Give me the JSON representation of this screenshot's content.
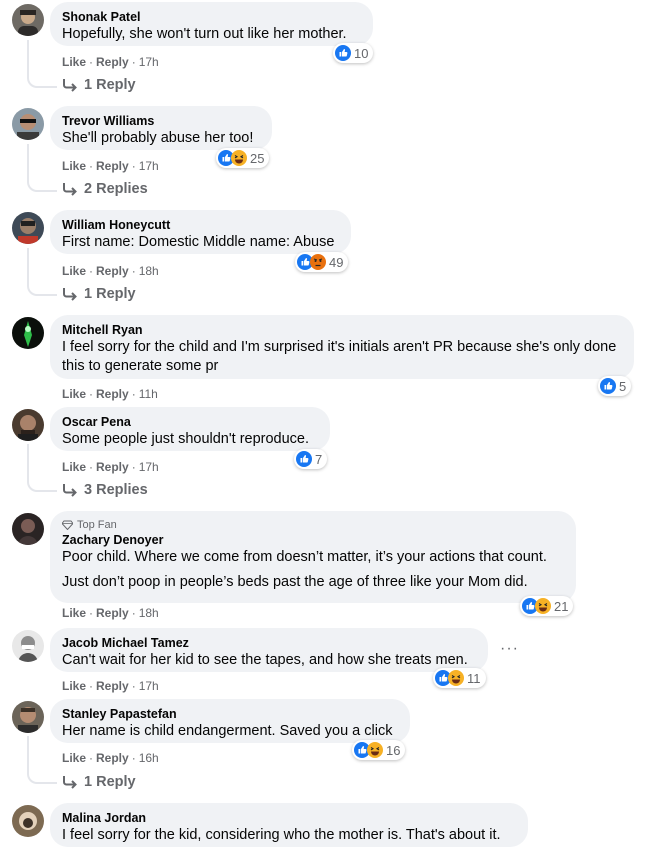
{
  "ui": {
    "like": "Like",
    "reply": "Reply",
    "sep": "·"
  },
  "comments": [
    {
      "author": "Shonak Patel",
      "text": [
        "Hopefully, she won't turn out like her mother."
      ],
      "time": "17h",
      "reactions": "10",
      "replies": "1 Reply"
    },
    {
      "author": "Trevor Williams",
      "text": [
        "She'll probably abuse her too!"
      ],
      "time": "17h",
      "reactions": "25",
      "replies": "2 Replies"
    },
    {
      "author": "William Honeycutt",
      "text": [
        "First name: Domestic Middle name: Abuse"
      ],
      "time": "18h",
      "reactions": "49",
      "replies": "1 Reply"
    },
    {
      "author": "Mitchell Ryan",
      "text": [
        "I feel sorry for the child and I'm surprised it's initials aren't PR because she's only done this to generate some pr"
      ],
      "time": "11h",
      "reactions": "5"
    },
    {
      "author": "Oscar Pena",
      "text": [
        "Some people just shouldn't reproduce."
      ],
      "time": "17h",
      "reactions": "7",
      "replies": "3 Replies"
    },
    {
      "badge": "Top Fan",
      "author": "Zachary Denoyer",
      "text": [
        "Poor child. Where we come from doesn’t matter, it’s your actions that count.",
        "Just don’t poop in people’s beds past the age of three like your Mom did."
      ],
      "time": "18h",
      "reactions": "21"
    },
    {
      "author": "Jacob Michael Tamez",
      "text": [
        "Can't wait for her kid to see the tapes, and how she treats men."
      ],
      "time": "17h",
      "reactions": "11",
      "more": "···"
    },
    {
      "author": "Stanley Papastefan",
      "text": [
        "Her name is child endangerment. Saved you a click"
      ],
      "time": "16h",
      "reactions": "16",
      "replies": "1 Reply"
    },
    {
      "author": "Malina Jordan",
      "text": [
        "I feel sorry for the kid, considering who the mother is. That's about it."
      ]
    }
  ],
  "colors": {
    "like_blue": "#1877f2",
    "haha_yellow": "#f7b125",
    "bubble": "#f0f2f5",
    "meta": "#65676b"
  }
}
